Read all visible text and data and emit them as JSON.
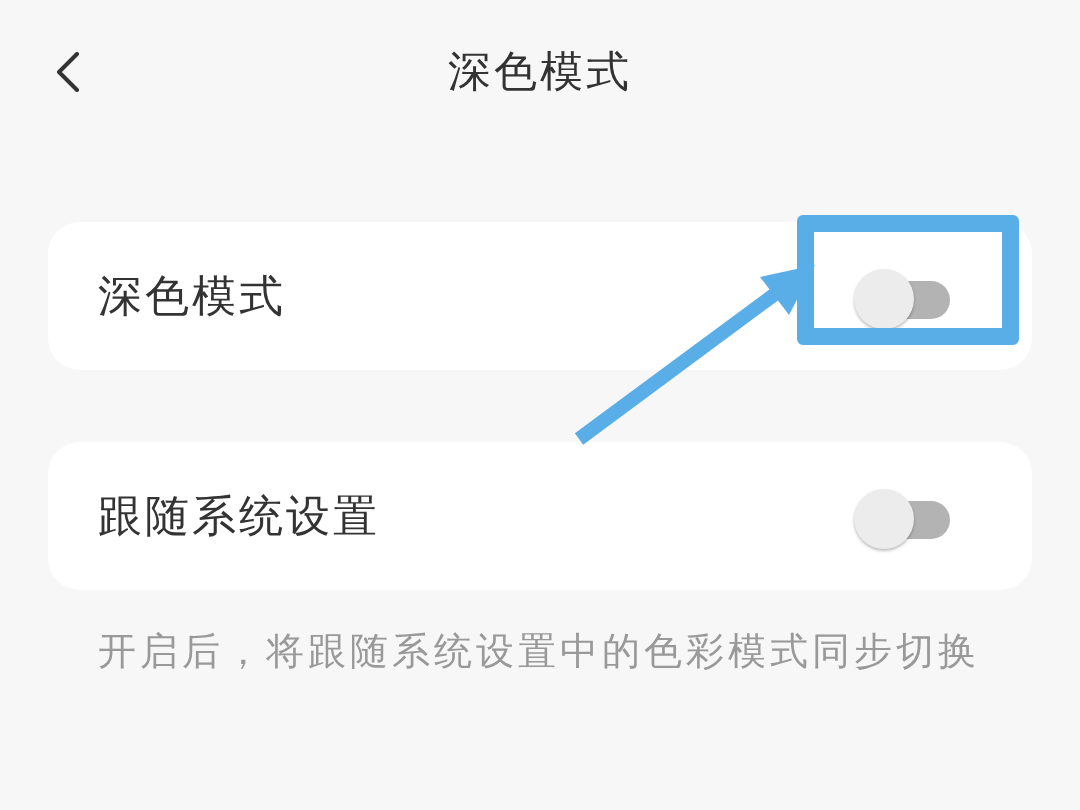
{
  "header": {
    "title": "深色模式"
  },
  "settings": [
    {
      "label": "深色模式",
      "on": false,
      "highlighted": true
    },
    {
      "label": "跟随系统设置",
      "on": false,
      "highlighted": false
    }
  ],
  "hint": "开启后，将跟随系统设置中的色彩模式同步切换"
}
